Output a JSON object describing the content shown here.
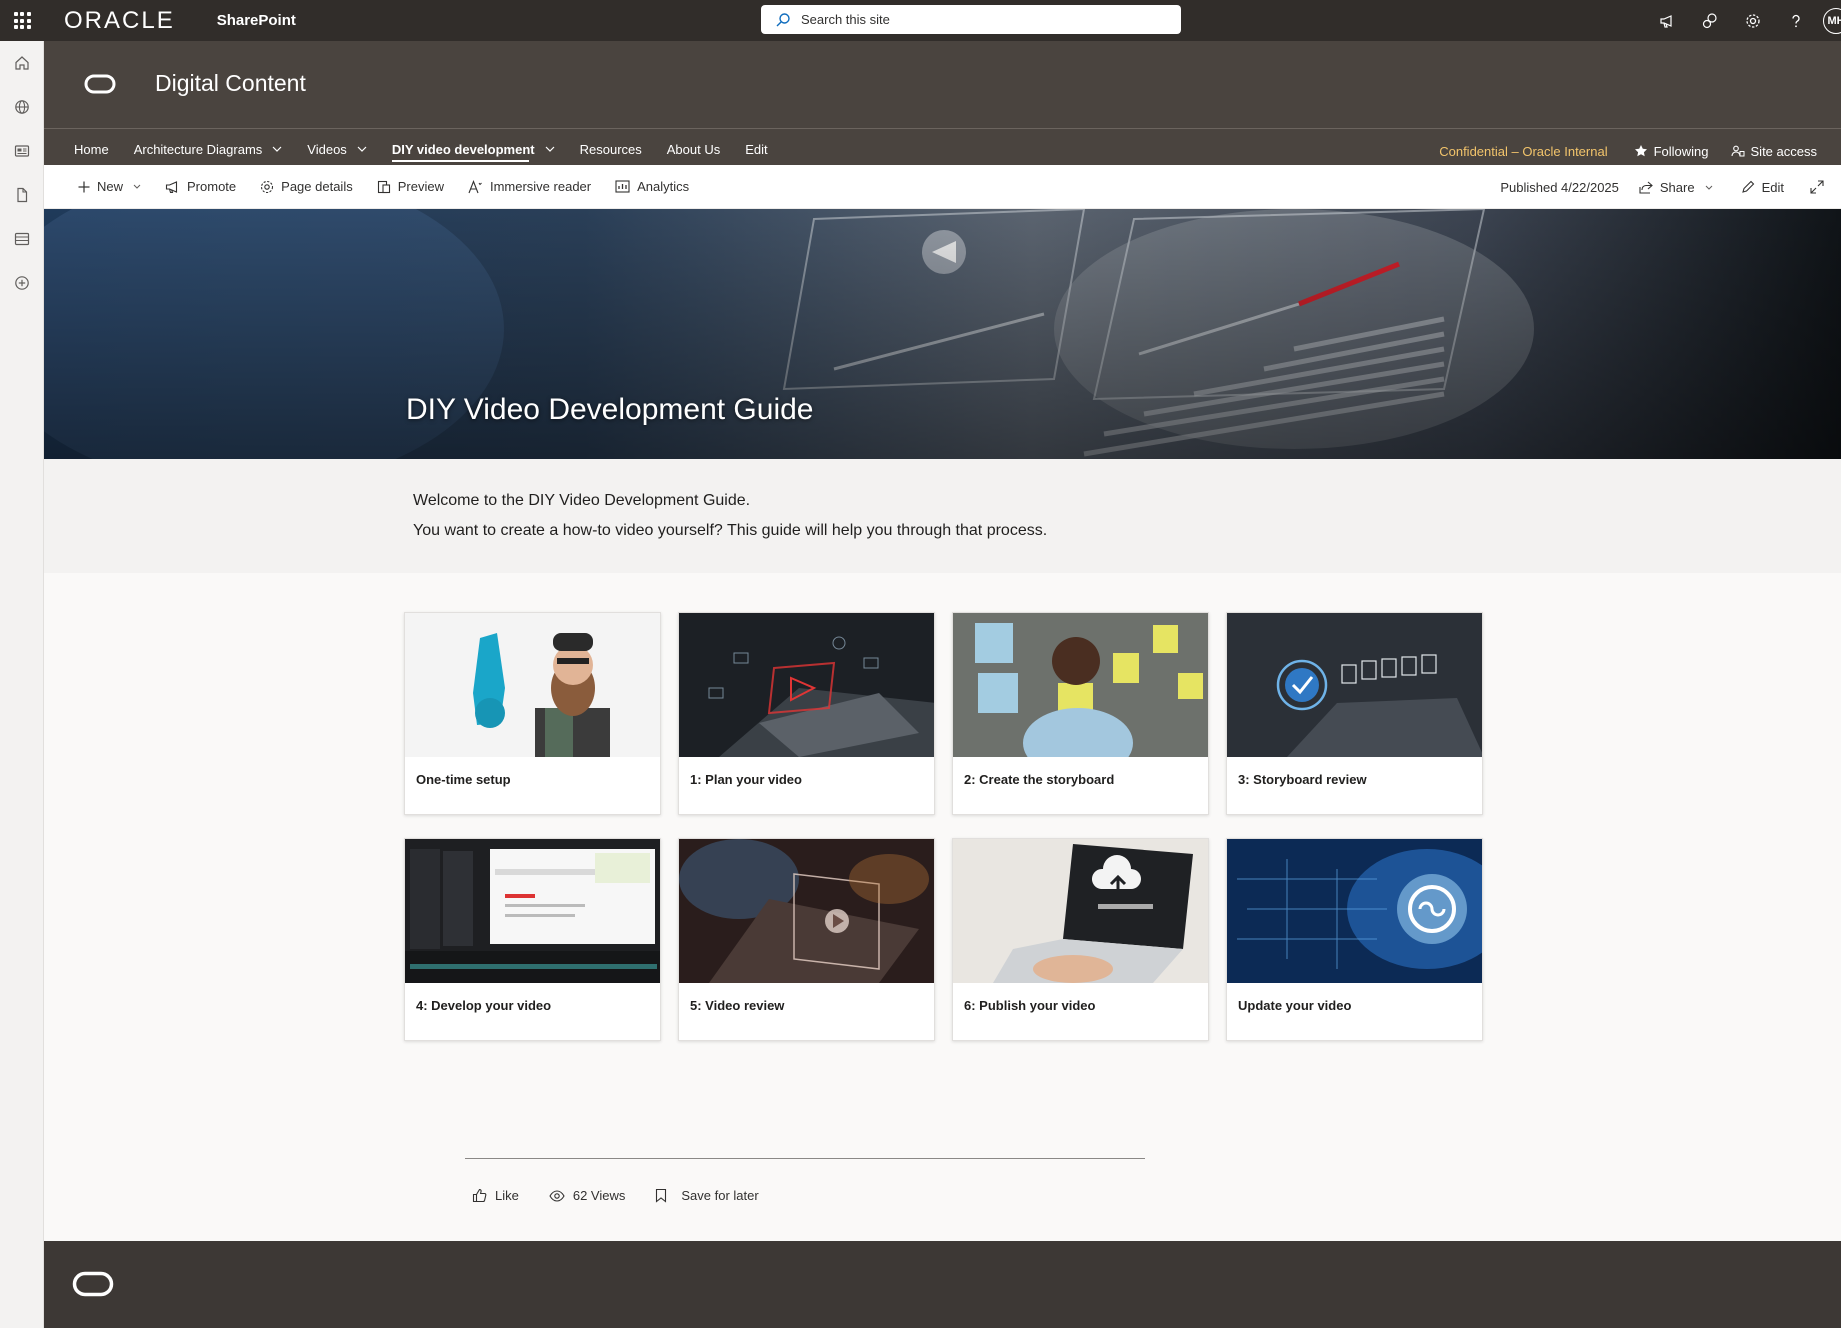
{
  "suitebar": {
    "brand": "ORACLE",
    "app_name": "SharePoint",
    "search_placeholder": "Search this site",
    "user_initials": "MH"
  },
  "site": {
    "title": "Digital Content",
    "nav": [
      {
        "label": "Home"
      },
      {
        "label": "Architecture Diagrams"
      },
      {
        "label": "Videos"
      },
      {
        "label": "DIY video development"
      },
      {
        "label": "Resources"
      },
      {
        "label": "About Us"
      },
      {
        "label": "Edit"
      }
    ],
    "confidential": "Confidential – Oracle Internal",
    "following": "Following",
    "site_access": "Site access"
  },
  "commandbar": {
    "new": "New",
    "promote": "Promote",
    "page_details": "Page details",
    "preview": "Preview",
    "immersive_reader": "Immersive reader",
    "analytics": "Analytics",
    "published": "Published 4/22/2025",
    "share": "Share",
    "edit": "Edit"
  },
  "hero": {
    "title": "DIY Video Development Guide"
  },
  "intro": {
    "line1": "Welcome to the DIY Video Development Guide.",
    "line2": "You want to create a how-to video yourself? This guide will help you through that process."
  },
  "cards": [
    {
      "label": "One-time setup"
    },
    {
      "label": "1: Plan your video"
    },
    {
      "label": "2: Create the storyboard"
    },
    {
      "label": "3: Storyboard review"
    },
    {
      "label": "4: Develop your video"
    },
    {
      "label": "5: Video review"
    },
    {
      "label": "6: Publish your video"
    },
    {
      "label": "Update your video"
    }
  ],
  "social": {
    "like": "Like",
    "views": "62 Views",
    "save": "Save for later"
  },
  "colors": {
    "suitebar": "#312d2a",
    "header": "#4a443f",
    "confidential": "#f2c46b",
    "footer": "#3d3835"
  }
}
